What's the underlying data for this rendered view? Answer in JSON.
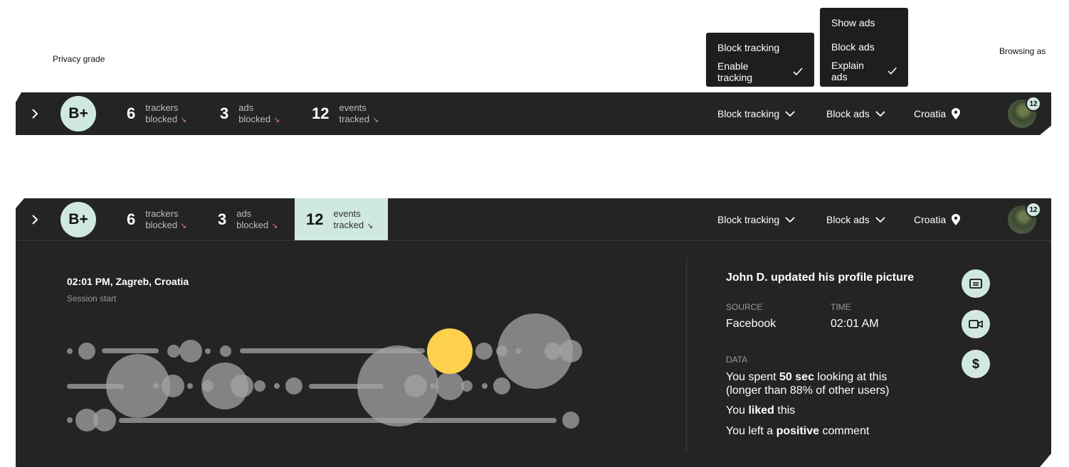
{
  "annotations": {
    "privacy_grade": "Privacy grade",
    "browsing_as": "Browsing as"
  },
  "toolbar": {
    "grade": "B+",
    "stats": [
      {
        "number": "6",
        "line1": "trackers",
        "line2": "blocked",
        "arrow": "↘"
      },
      {
        "number": "3",
        "line1": "ads",
        "line2": "blocked",
        "arrow": "↘"
      },
      {
        "number": "12",
        "line1": "events",
        "line2": "tracked",
        "arrow": "↘"
      }
    ],
    "tracking_menu": "Block tracking",
    "ads_menu": "Block ads",
    "location": "Croatia",
    "notification_count": "12"
  },
  "tracking_dropdown": {
    "items": [
      {
        "label": "Block tracking",
        "checked": false
      },
      {
        "label": "Enable tracking",
        "checked": true
      }
    ]
  },
  "ads_dropdown": {
    "items": [
      {
        "label": "Show ads",
        "checked": false
      },
      {
        "label": "Block ads",
        "checked": false
      },
      {
        "label": "Explain ads",
        "checked": true
      }
    ]
  },
  "session": {
    "title": "02:01 PM, Zagreb, Croatia",
    "subtitle": "Session start"
  },
  "event_detail": {
    "title": "John D. updated his profile picture",
    "source_label": "SOURCE",
    "source_value": "Facebook",
    "time_label": "TIME",
    "time_value": "02:01 AM",
    "data_label": "DATA",
    "line1_pre": "You spent ",
    "line1_bold": "50 sec",
    "line1_post": " looking at this",
    "line1b": "(longer than 88% of other users)",
    "line2_pre": "You ",
    "line2_bold": "liked",
    "line2_post": " this",
    "line3_pre": "You left a ",
    "line3_bold": "positive",
    "line3_post": " comment"
  },
  "icons": {
    "chevron": "chevron-right-icon",
    "dropdown": "chevron-down-icon",
    "location": "map-pin-icon",
    "check": "check-icon",
    "event_icons": [
      "news-icon",
      "video-icon",
      "dollar-icon"
    ]
  },
  "colors": {
    "bar_bg": "#242424",
    "accent": "#cfe8e0",
    "highlight_bubble": "#fdd04e",
    "arrow": "#e07a86"
  }
}
